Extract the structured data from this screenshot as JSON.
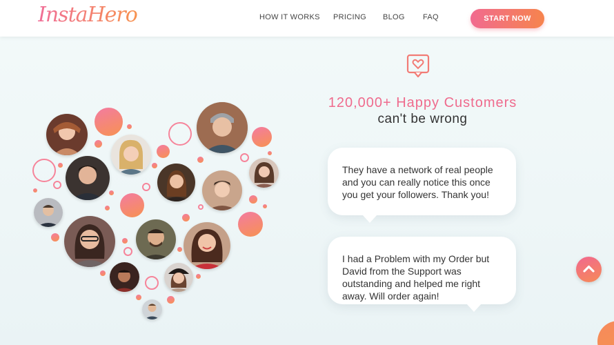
{
  "header": {
    "logo": "InstaHero",
    "nav": [
      "HOW IT WORKS",
      "PRICING",
      "BLOG",
      "FAQ"
    ],
    "cta": "START NOW"
  },
  "hero": {
    "heading_accent": "120,000+ Happy Customers",
    "heading_rest": "can't be wrong",
    "icon": "heart-chat-icon"
  },
  "testimonials": [
    {
      "text": "They have a network of real people and you can really notice this once you get your followers. Thank you!"
    },
    {
      "text": "I had a Problem with my Order but David from the Support was outstanding and helped me right away. Will order again!"
    }
  ],
  "widgets": {
    "scroll_top_icon": "chevron-up-icon"
  },
  "colors": {
    "accent_pink": "#ef6b8d",
    "accent_orange": "#f7934f",
    "background": "#f3fafa"
  }
}
